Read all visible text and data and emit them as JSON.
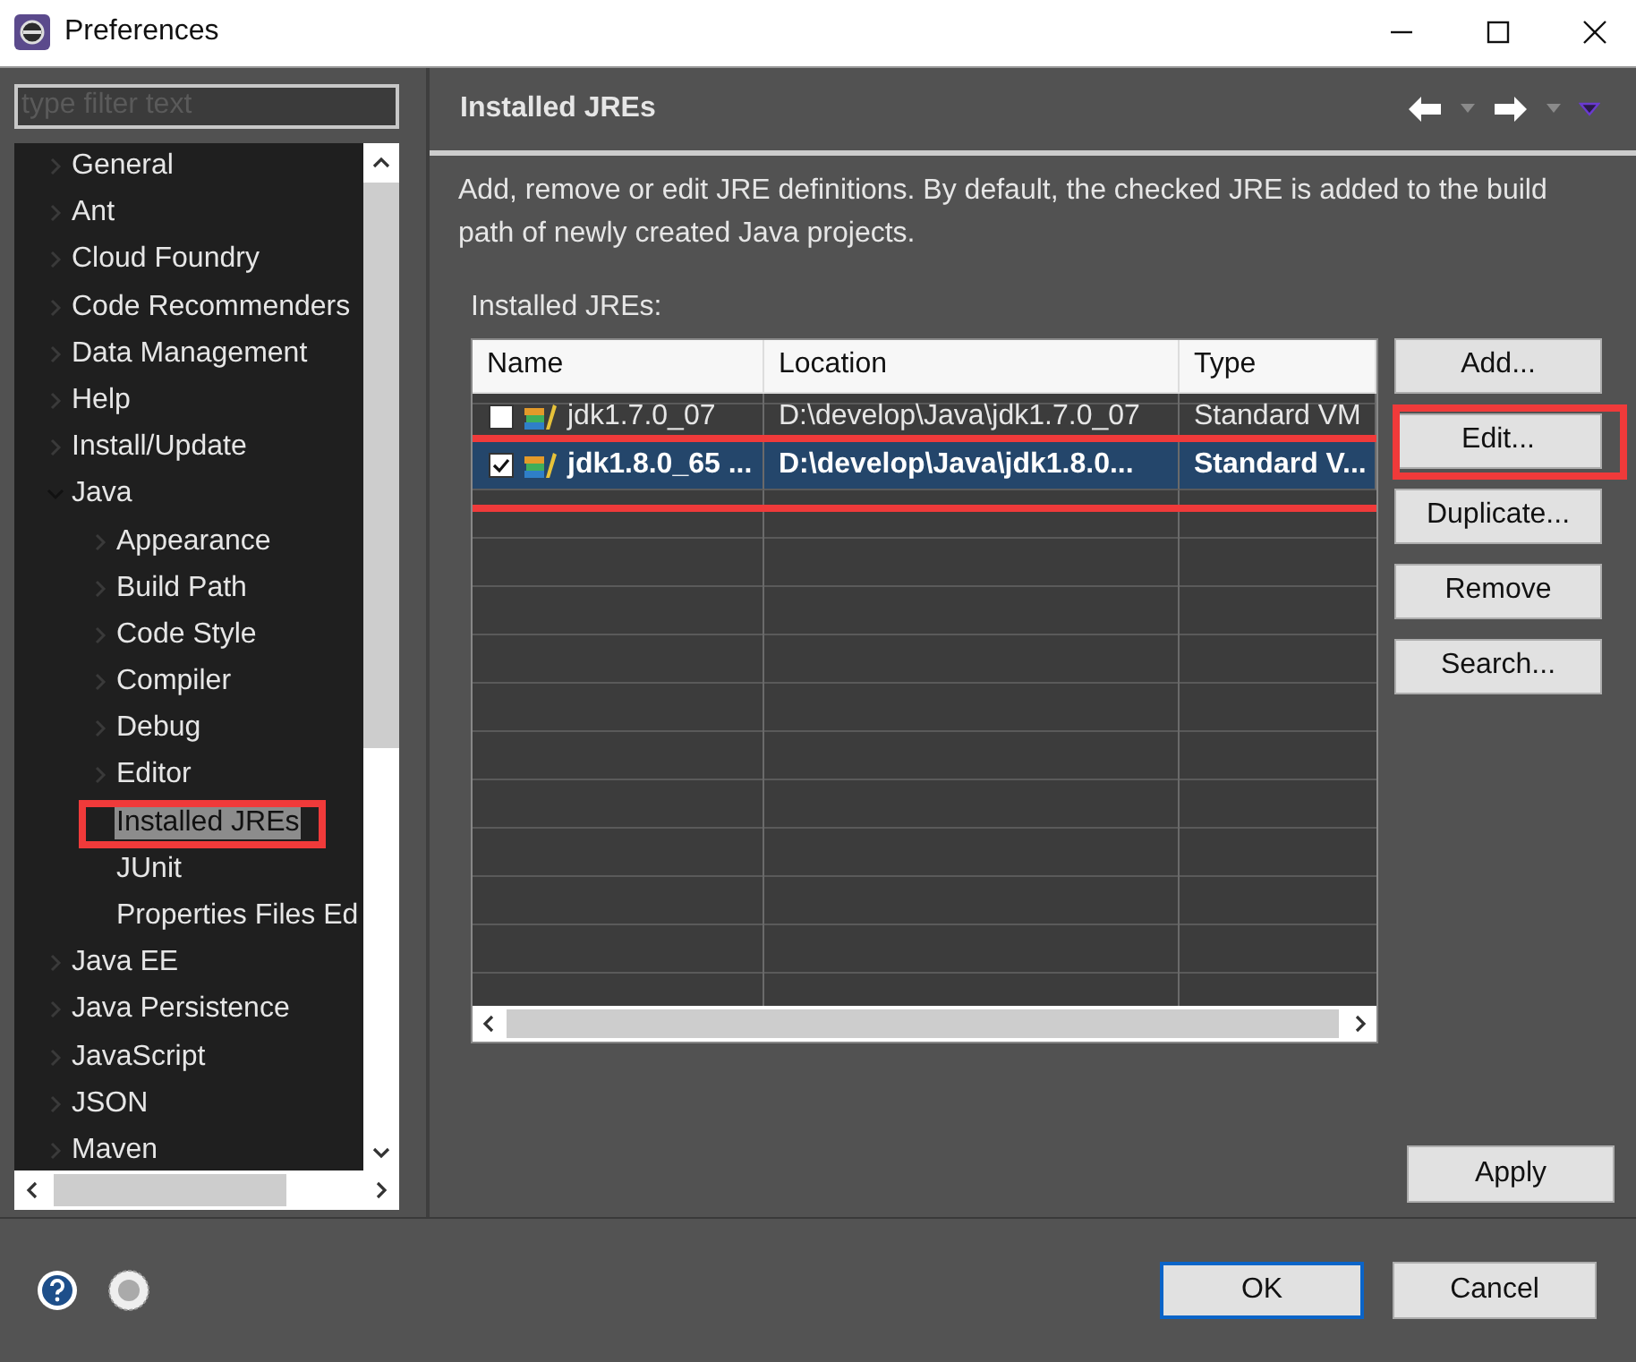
{
  "window": {
    "title": "Preferences"
  },
  "filter": {
    "placeholder": "type filter text"
  },
  "tree": [
    {
      "label": "General",
      "expanded": false,
      "selected": false
    },
    {
      "label": "Ant",
      "expanded": false,
      "selected": false
    },
    {
      "label": "Cloud Foundry",
      "expanded": false,
      "selected": false
    },
    {
      "label": "Code Recommenders",
      "expanded": false,
      "selected": false
    },
    {
      "label": "Data Management",
      "expanded": false,
      "selected": false
    },
    {
      "label": "Help",
      "expanded": false,
      "selected": false
    },
    {
      "label": "Install/Update",
      "expanded": false,
      "selected": false
    },
    {
      "label": "Java",
      "expanded": true,
      "selected": false,
      "children": [
        {
          "label": "Appearance",
          "expanded": false,
          "selected": false
        },
        {
          "label": "Build Path",
          "expanded": false,
          "selected": false
        },
        {
          "label": "Code Style",
          "expanded": false,
          "selected": false
        },
        {
          "label": "Compiler",
          "expanded": false,
          "selected": false
        },
        {
          "label": "Debug",
          "expanded": false,
          "selected": false
        },
        {
          "label": "Editor",
          "expanded": false,
          "selected": false
        },
        {
          "label": "Installed JREs",
          "selected": true,
          "highlighted": true
        },
        {
          "label": "JUnit",
          "selected": false
        },
        {
          "label": "Properties Files Ed",
          "selected": false
        }
      ]
    },
    {
      "label": "Java EE",
      "expanded": false,
      "selected": false
    },
    {
      "label": "Java Persistence",
      "expanded": false,
      "selected": false
    },
    {
      "label": "JavaScript",
      "expanded": false,
      "selected": false
    },
    {
      "label": "JSON",
      "expanded": false,
      "selected": false
    },
    {
      "label": "Maven",
      "expanded": false,
      "selected": false
    }
  ],
  "page": {
    "title": "Installed JREs",
    "description": "Add, remove or edit JRE definitions. By default, the checked JRE is added to the build path of newly created Java projects.",
    "table_label": "Installed JREs:"
  },
  "table": {
    "columns": [
      "Name",
      "Location",
      "Type"
    ],
    "rows": [
      {
        "name": "jdk1.7.0_07",
        "location": "D:\\develop\\Java\\jdk1.7.0_07",
        "type": "Standard VM",
        "checked": false,
        "selected": false,
        "highlighted": false
      },
      {
        "name": "jdk1.8.0_65 ...",
        "location": "D:\\develop\\Java\\jdk1.8.0...",
        "type": "Standard V...",
        "checked": true,
        "selected": true,
        "highlighted": true
      }
    ]
  },
  "side_buttons": [
    {
      "label": "Add...",
      "highlighted": false
    },
    {
      "label": "Edit...",
      "highlighted": true
    },
    {
      "label": "Duplicate...",
      "highlighted": false
    },
    {
      "label": "Remove",
      "highlighted": false
    },
    {
      "label": "Search...",
      "highlighted": false
    }
  ],
  "apply_button": "Apply",
  "footer_buttons": [
    {
      "label": "OK",
      "default": true
    },
    {
      "label": "Cancel",
      "default": false
    }
  ]
}
